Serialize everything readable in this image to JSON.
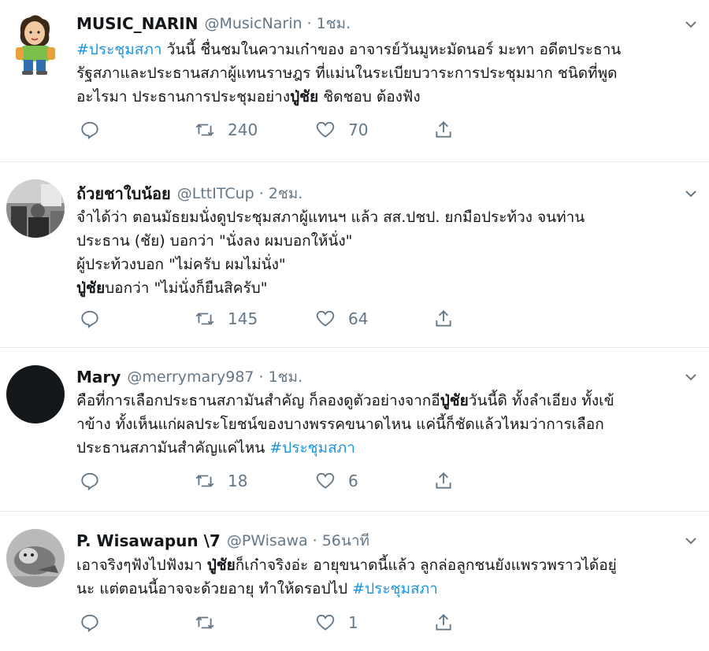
{
  "tweets": [
    {
      "name": "MUSIC_NARIN",
      "handle": "@MusicNarin",
      "time": "1ชม.",
      "lines": [
        [
          {
            "t": "#ประชุมสภา",
            "h": true
          },
          {
            "t": " วันนี้ ชื่นชมในความเก๋าของ อาจารย์วันมูหะมัดนอร์ มะทา อดีตประธาน"
          }
        ],
        [
          {
            "t": "รัฐสภาและประธานสภาผู้แทนราษฎร ที่แม่นในระเบียบวาระการประชุมมาก ชนิดที่พูด"
          }
        ],
        [
          {
            "t": "อะไรมา ประธานการประชุมอย่าง"
          },
          {
            "t": "ปู่ชัย",
            "b": true
          },
          {
            "t": " ชิดชอบ ต้องฟัง"
          }
        ]
      ],
      "retweets": "240",
      "likes": "70"
    },
    {
      "name": "ถ้วยชาใบน้อย",
      "handle": "@LttITCup",
      "time": "2ชม.",
      "lines": [
        [
          {
            "t": "จำได้ว่า ตอนมัธยมนั่งดูประชุมสภาผู้แทนฯ แล้ว สส.ปชป. ยกมือประท้วง จนท่าน"
          }
        ],
        [
          {
            "t": "ประธาน (ชัย) บอกว่า \"นั่งลง ผมบอกให้นั่ง\""
          }
        ],
        [
          {
            "t": "ผู้ประท้วงบอก \"ไม่ครับ ผมไม่นั่ง\""
          }
        ],
        [
          {
            "t": "ปู่ชัย",
            "b": true
          },
          {
            "t": "บอกว่า \"ไม่นั่งก็ยืนสิครับ\""
          }
        ]
      ],
      "retweets": "145",
      "likes": "64"
    },
    {
      "name": "Mary",
      "handle": "@merrymary987",
      "time": "1ชม.",
      "lines": [
        [
          {
            "t": "คือที่การเลือกประธานสภามันสำคัญ ก็ลองดูตัวอย่างจากอี"
          },
          {
            "t": "ปู่ชัย",
            "b": true
          },
          {
            "t": "วันนี้ดิ ทั้งลำเอียง ทั้งเข้"
          }
        ],
        [
          {
            "t": "าข้าง ทั้งเห็นแก่ผลประโยชน์ของบางพรรคขนาดไหน แค่นี้ก็ชัดแล้วไหมว่าการเลือก"
          }
        ],
        [
          {
            "t": "ประธานสภามันสำคัญแค่ไหน "
          },
          {
            "t": "#ประชุมสภา",
            "h": true
          }
        ]
      ],
      "retweets": "18",
      "likes": "6"
    },
    {
      "name": "P. Wisawapun \\7",
      "handle": "@PWisawa",
      "time": "56นาที",
      "lines": [
        [
          {
            "t": "เอาจริงๆฟังไปฟังมา "
          },
          {
            "t": "ปู่ชัย",
            "b": true
          },
          {
            "t": "ก็เก๋าจริงอ่ะ อายุขนาดนี้แล้ว ลูกล่อลูกชนยังแพรวพราวได้อยู่"
          }
        ],
        [
          {
            "t": "นะ แต่ตอนนี้อาจจะด้วยอายุ ทำให้ดรอปไป "
          },
          {
            "t": "#ประชุมสภา",
            "h": true
          }
        ]
      ],
      "retweets": "",
      "likes": "1"
    }
  ],
  "colors": {
    "hashtag": "#1b95e0",
    "muted": "#657786",
    "divider": "#e6ecf0"
  }
}
